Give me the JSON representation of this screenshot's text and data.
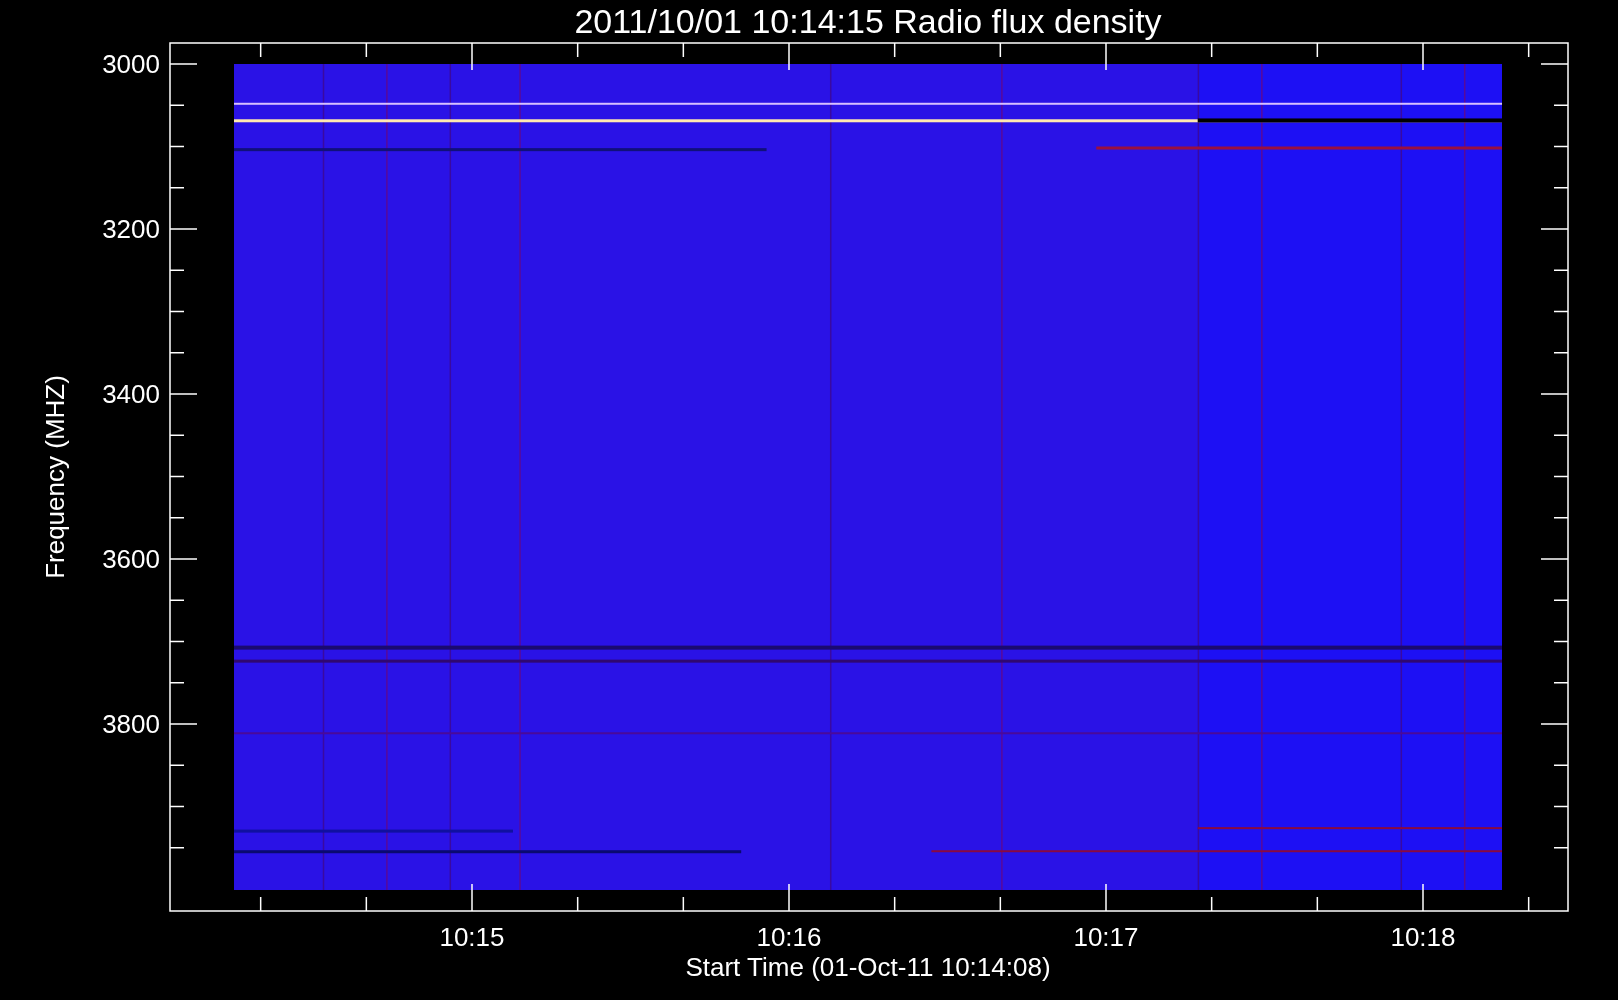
{
  "title": "2011/10/01 10:14:15 Radio flux density",
  "y_axis": {
    "label": "Frequency (MHZ)",
    "tick_labels": [
      "3000",
      "3200",
      "3400",
      "3600",
      "3800"
    ]
  },
  "x_axis": {
    "label": "Start Time (01-Oct-11 10:14:08)",
    "tick_labels": [
      "10:15",
      "10:16",
      "10:17",
      "10:18"
    ]
  }
}
